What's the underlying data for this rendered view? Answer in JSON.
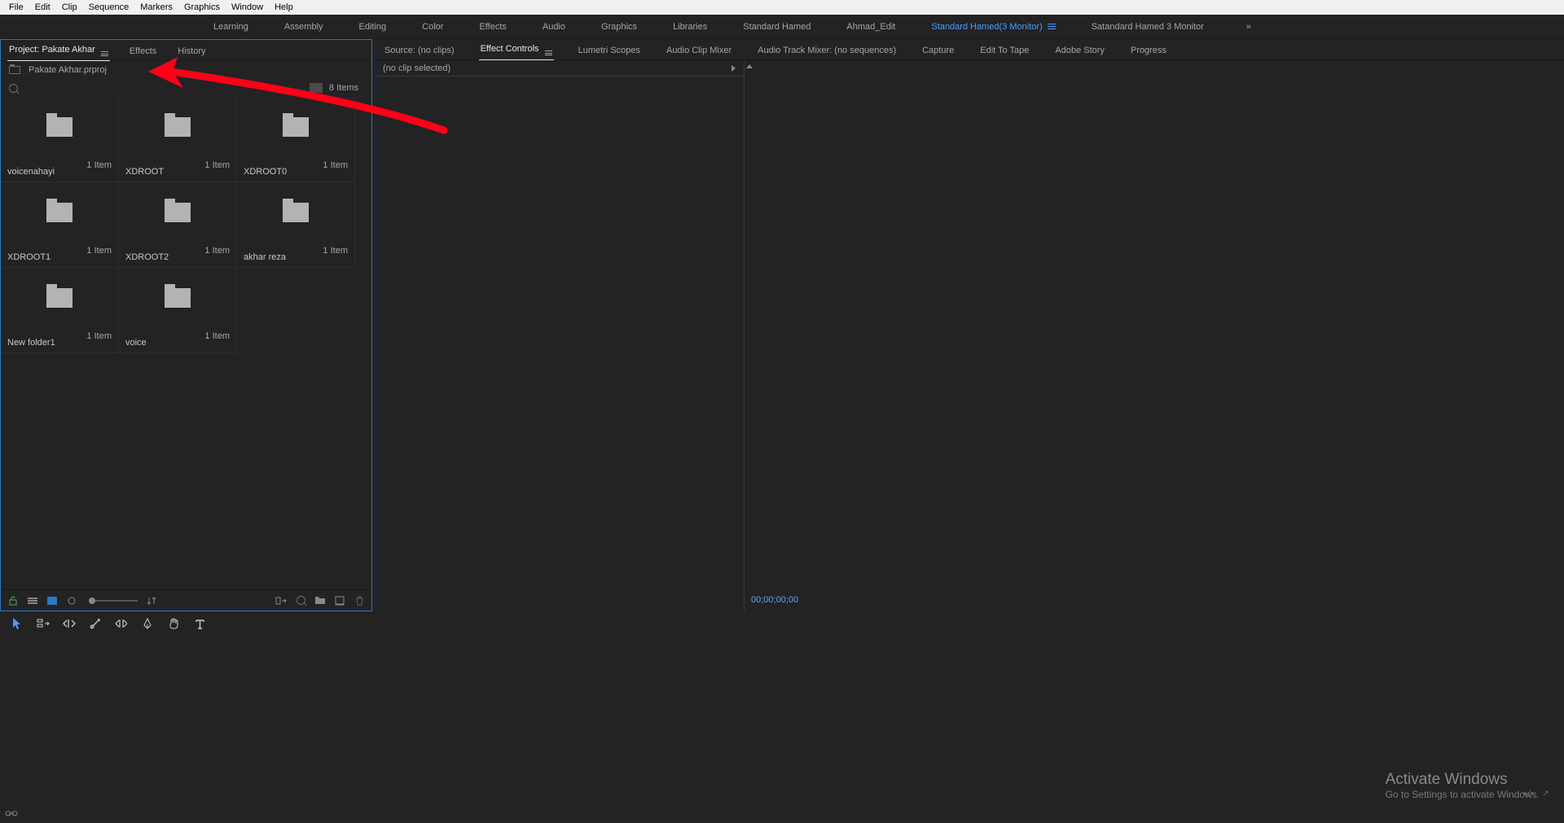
{
  "os_menu": [
    "File",
    "Edit",
    "Clip",
    "Sequence",
    "Markers",
    "Graphics",
    "Window",
    "Help"
  ],
  "workspaces": {
    "items": [
      "Learning",
      "Assembly",
      "Editing",
      "Color",
      "Effects",
      "Audio",
      "Graphics",
      "Libraries",
      "Standard Hamed",
      "Ahmad_Edit",
      "Standard Hamed(3 Monitor)",
      "Satandard Hamed 3 Monitor"
    ],
    "active_index": 10,
    "overflow": "»"
  },
  "left": {
    "tabs": [
      "Project: Pakate Akhar",
      "Effects",
      "History"
    ],
    "active_tab": 0,
    "project_file": "Pakate Akhar.prproj",
    "item_count": "8 Items",
    "bins": [
      {
        "name": "voicenahayi",
        "count": "1 Item"
      },
      {
        "name": "XDROOT",
        "count": "1 Item"
      },
      {
        "name": "XDROOT0",
        "count": "1 Item"
      },
      {
        "name": "XDROOT1",
        "count": "1 Item"
      },
      {
        "name": "XDROOT2",
        "count": "1 Item"
      },
      {
        "name": "akhar reza",
        "count": "1 Item"
      },
      {
        "name": "New folder1",
        "count": "1 Item"
      },
      {
        "name": "voice",
        "count": "1 Item"
      }
    ]
  },
  "source_tabs": {
    "items": [
      "Source: (no clips)",
      "Effect Controls",
      "Lumetri Scopes",
      "Audio Clip Mixer",
      "Audio Track Mixer: (no sequences)",
      "Capture",
      "Edit To Tape",
      "Adobe Story",
      "Progress"
    ],
    "active_index": 1
  },
  "effect_controls": {
    "no_clip": "(no clip selected)",
    "timecode": "00;00;00;00"
  },
  "tools": [
    "selection",
    "track-select",
    "ripple",
    "rolling",
    "rate-stretch",
    "razor",
    "slip",
    "hand",
    "type"
  ],
  "activate": {
    "title": "Activate Windows",
    "sub": "Go to Settings to activate Windows."
  }
}
